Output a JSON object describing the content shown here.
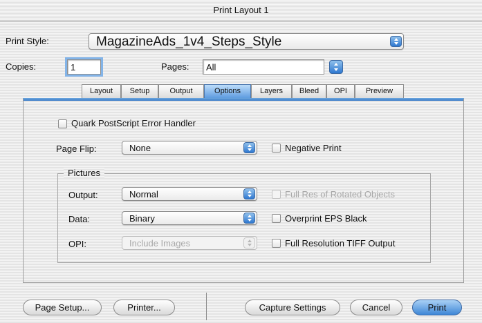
{
  "window": {
    "title": "Print Layout 1"
  },
  "print_style": {
    "label": "Print Style:",
    "value": "MagazineAds_1v4_Steps_Style"
  },
  "copies": {
    "label": "Copies:",
    "value": "1"
  },
  "pages": {
    "label": "Pages:",
    "value": "All"
  },
  "tabs": [
    {
      "label": "Layout",
      "active": false
    },
    {
      "label": "Setup",
      "active": false
    },
    {
      "label": "Output",
      "active": false
    },
    {
      "label": "Options",
      "active": true
    },
    {
      "label": "Layers",
      "active": false
    },
    {
      "label": "Bleed",
      "active": false
    },
    {
      "label": "OPI",
      "active": false
    },
    {
      "label": "Preview",
      "active": false
    }
  ],
  "options": {
    "error_handler": {
      "label": "Quark PostScript Error Handler",
      "checked": false
    },
    "page_flip": {
      "label": "Page Flip:",
      "value": "None"
    },
    "negative_print": {
      "label": "Negative Print",
      "checked": false
    },
    "pictures": {
      "title": "Pictures",
      "output": {
        "label": "Output:",
        "value": "Normal"
      },
      "data": {
        "label": "Data:",
        "value": "Binary"
      },
      "opi": {
        "label": "OPI:",
        "value": "Include Images",
        "enabled": false
      },
      "full_res_rotated": {
        "label": "Full Res of Rotated Objects",
        "checked": false,
        "enabled": false
      },
      "overprint_eps": {
        "label": "Overprint EPS Black",
        "checked": false
      },
      "full_res_tiff": {
        "label": "Full Resolution TIFF Output",
        "checked": false
      }
    }
  },
  "buttons": {
    "page_setup": "Page Setup...",
    "printer": "Printer...",
    "capture_settings": "Capture Settings",
    "cancel": "Cancel",
    "print": "Print"
  },
  "colors": {
    "accent": "#3d86d6",
    "tab_active": "#5f9ce0",
    "panel_line": "#3a7bc8"
  }
}
